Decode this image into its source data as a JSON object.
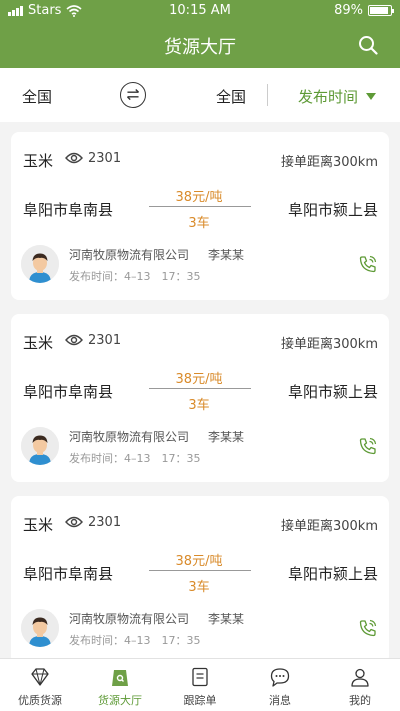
{
  "status": {
    "carrier": "Stars",
    "time": "10:15 AM",
    "battery": "89%",
    "battery_level": 0.89
  },
  "header": {
    "title": "货源大厅"
  },
  "filter": {
    "origin": "全国",
    "destination": "全国",
    "sort_label": "发布时间"
  },
  "cards": [
    {
      "goods": "玉米",
      "views": "2301",
      "distance": "接单距离300km",
      "from": "阜阳市阜南县",
      "to": "阜阳市颍上县",
      "price": "38元/吨",
      "trucks": "3车",
      "company": "河南牧原物流有限公司",
      "person": "李某某",
      "publish_time": "发布时间：4–13　17：35"
    },
    {
      "goods": "玉米",
      "views": "2301",
      "distance": "接单距离300km",
      "from": "阜阳市阜南县",
      "to": "阜阳市颍上县",
      "price": "38元/吨",
      "trucks": "3车",
      "company": "河南牧原物流有限公司",
      "person": "李某某",
      "publish_time": "发布时间：4–13　17：35"
    },
    {
      "goods": "玉米",
      "views": "2301",
      "distance": "接单距离300km",
      "from": "阜阳市阜南县",
      "to": "阜阳市颍上县",
      "price": "38元/吨",
      "trucks": "3车",
      "company": "河南牧原物流有限公司",
      "person": "李某某",
      "publish_time": "发布时间：4–13　17：35"
    }
  ],
  "tabs": [
    {
      "label": "优质货源",
      "icon": "diamond-icon"
    },
    {
      "label": "货源大厅",
      "icon": "shopping-bag-icon"
    },
    {
      "label": "跟踪单",
      "icon": "document-icon"
    },
    {
      "label": "消息",
      "icon": "chat-bubble-icon"
    },
    {
      "label": "我的",
      "icon": "user-icon"
    }
  ],
  "colors": {
    "brand": "#6fa047",
    "accent_text": "#5e9a36",
    "price": "#d98b2b"
  }
}
